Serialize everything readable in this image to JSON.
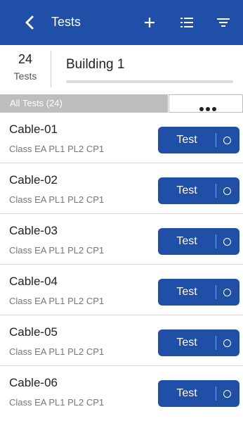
{
  "header": {
    "title": "Tests",
    "icons": [
      "back-chevron-icon",
      "add-icon",
      "list-icon",
      "filter-icon"
    ],
    "background_color": "#1f4fa6"
  },
  "summary": {
    "count": "24",
    "count_label": "Tests",
    "building_name": "Building 1"
  },
  "filter": {
    "all_tests_label": "All Tests (24)",
    "more_icon": "more-dots-icon"
  },
  "tests": [
    {
      "name": "Cable-01",
      "spec": "Class EA PL1 PL2 CP1",
      "button_label": "Test"
    },
    {
      "name": "Cable-02",
      "spec": "Class EA PL1 PL2 CP1",
      "button_label": "Test"
    },
    {
      "name": "Cable-03",
      "spec": "Class EA PL1 PL2 CP1",
      "button_label": "Test"
    },
    {
      "name": "Cable-04",
      "spec": "Class EA PL1 PL2 CP1",
      "button_label": "Test"
    },
    {
      "name": "Cable-05",
      "spec": "Class EA PL1 PL2 CP1",
      "button_label": "Test"
    },
    {
      "name": "Cable-06",
      "spec": "Class EA PL1 PL2 CP1",
      "button_label": "Test"
    }
  ]
}
